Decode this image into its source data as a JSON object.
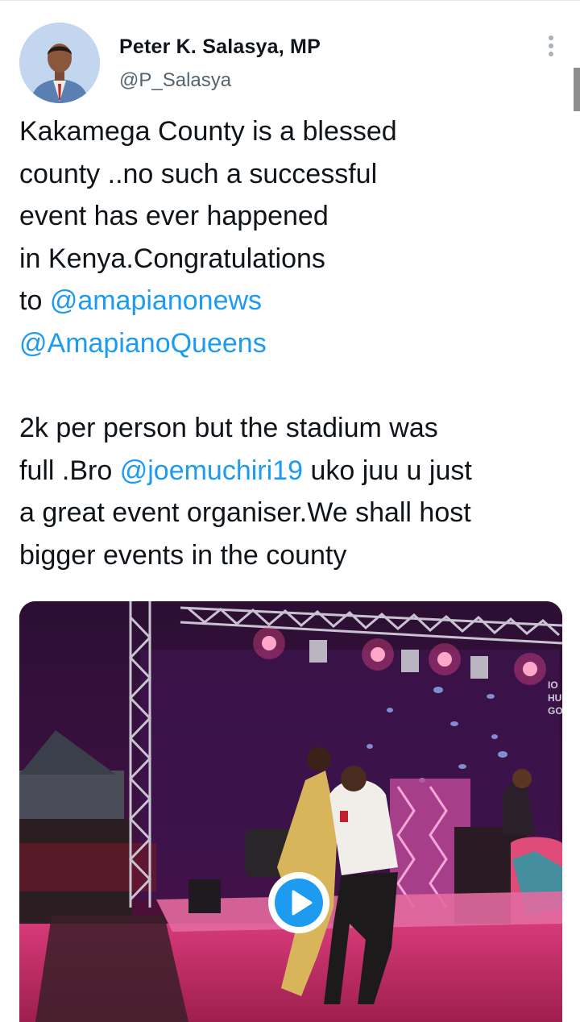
{
  "tweet": {
    "author": {
      "display_name": "Peter K. Salasya, MP",
      "handle": "@P_Salasya",
      "avatar_icon": "profile-photo"
    },
    "lines": [
      {
        "text": "Kakamega County is a blessed"
      },
      {
        "text": "county ..no such a successful"
      },
      {
        "text": "event has ever happened"
      },
      {
        "text": "in Kenya.Congratulations"
      },
      {
        "prefix": "to ",
        "mention": "@amapianonews"
      },
      {
        "mention": "@AmapianoQueens"
      },
      {
        "text": ""
      },
      {
        "text": "2k per person but the stadium was"
      },
      {
        "prefix": "full .Bro ",
        "mention": "@joemuchiri19",
        "suffix": " uko juu u just"
      },
      {
        "text": "a great event organiser.We shall host"
      },
      {
        "text": "bigger events in the county"
      }
    ],
    "media": {
      "type": "video",
      "play_icon": "play-icon",
      "stage_sign_text": [
        "IO",
        "HU",
        "GO"
      ]
    },
    "more_icon": "more-vertical-icon"
  },
  "colors": {
    "text": "#0f1419",
    "secondary_text": "#536471",
    "link": "#1d9bf0",
    "play_button": "#1d9bf0",
    "stage_wash": "#e8307a"
  }
}
